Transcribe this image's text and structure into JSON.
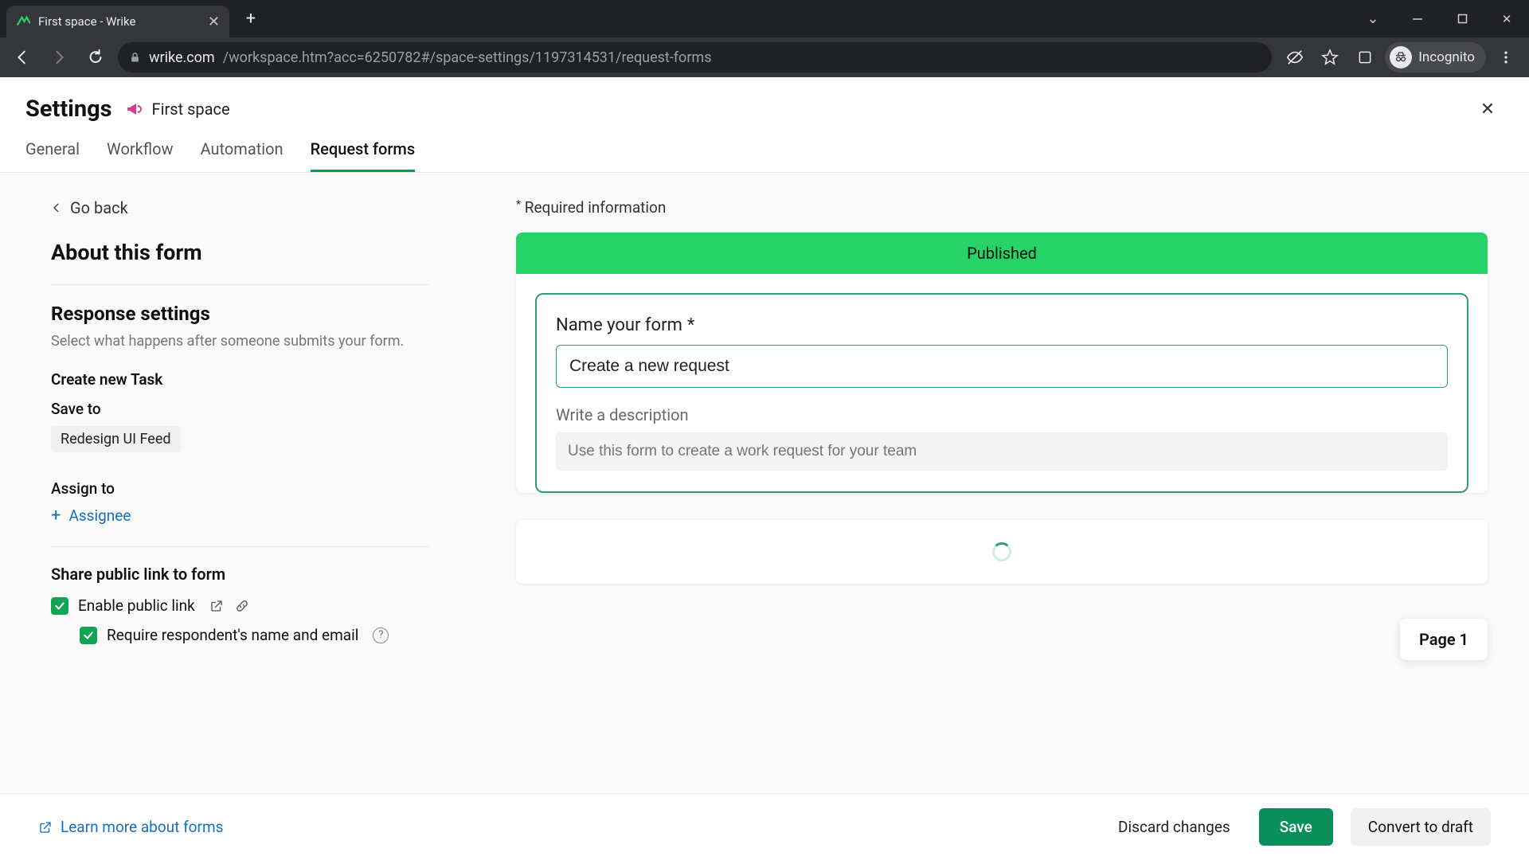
{
  "browser": {
    "tab_title": "First space - Wrike",
    "url_host": "wrike.com",
    "url_path": "/workspace.htm?acc=6250782#/space-settings/1197314531/request-forms",
    "incognito_label": "Incognito"
  },
  "header": {
    "title": "Settings",
    "space_name": "First space"
  },
  "tabs": {
    "general": "General",
    "workflow": "Workflow",
    "automation": "Automation",
    "request_forms": "Request forms"
  },
  "left": {
    "go_back": "Go back",
    "about_title": "About this form",
    "response_title": "Response settings",
    "response_desc": "Select what happens after someone submits your form.",
    "create_new_task": "Create new Task",
    "save_to_label": "Save to",
    "save_to_value": "Redesign UI Feed",
    "assign_to_label": "Assign to",
    "assignee_action": "Assignee",
    "share_title": "Share public link to form",
    "enable_public_link": "Enable public link",
    "require_name_email": "Require respondent's name and email"
  },
  "right": {
    "required_info": "Required information",
    "published_banner": "Published",
    "name_label": "Name your form",
    "name_value": "Create a new request",
    "desc_label": "Write a description",
    "desc_placeholder": "Use this form to create a work request for your team",
    "page_indicator": "Page 1"
  },
  "footer": {
    "learn_more": "Learn more about forms",
    "discard": "Discard changes",
    "save": "Save",
    "convert_draft": "Convert to draft"
  }
}
